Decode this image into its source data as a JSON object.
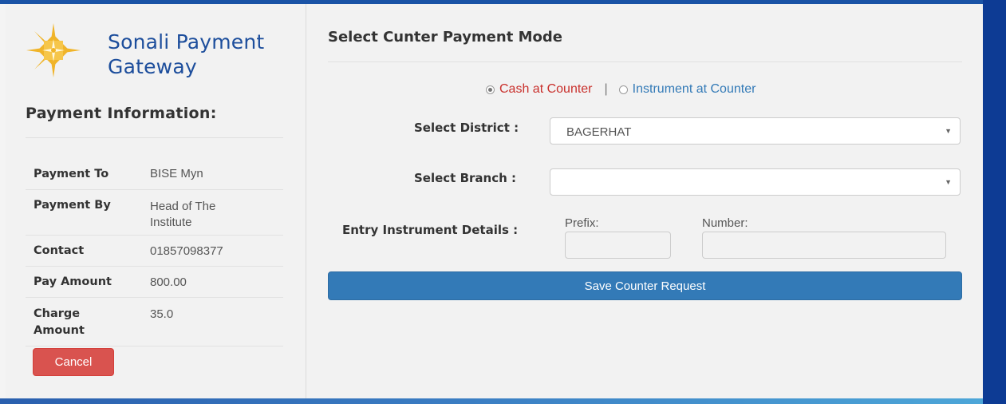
{
  "brand": {
    "line1": "Sonali Payment",
    "line2": "Gateway"
  },
  "payment_info": {
    "title": "Payment Information:",
    "rows": [
      {
        "label": "Payment To",
        "value": "BISE Myn"
      },
      {
        "label": "Payment By",
        "value_line1": "Head of The",
        "value_line2": "Institute"
      },
      {
        "label": "Contact",
        "value": "01857098377"
      },
      {
        "label": "Pay Amount",
        "value": "800.00"
      },
      {
        "label_line1": "Charge",
        "label_line2": "Amount",
        "value": "35.0"
      }
    ],
    "cancel_label": "Cancel"
  },
  "main": {
    "title": "Select Cunter Payment Mode",
    "mode": {
      "cash_label": "Cash at Counter",
      "separator": "|",
      "instrument_label": "Instrument at Counter",
      "selected": "cash"
    },
    "district": {
      "label": "Select District :",
      "value": "BAGERHAT"
    },
    "branch": {
      "label": "Select Branch :",
      "value": ""
    },
    "instrument": {
      "label": "Entry Instrument Details :",
      "prefix_label": "Prefix:",
      "number_label": "Number:"
    },
    "save_label": "Save Counter Request"
  },
  "colors": {
    "brand": "#1d4e9c",
    "logo_gold": "#f0b429",
    "cancel_button": "#d9534f",
    "save_button": "#337ab7",
    "cash_label": "#c9302c",
    "instrument_label": "#337ab7"
  }
}
